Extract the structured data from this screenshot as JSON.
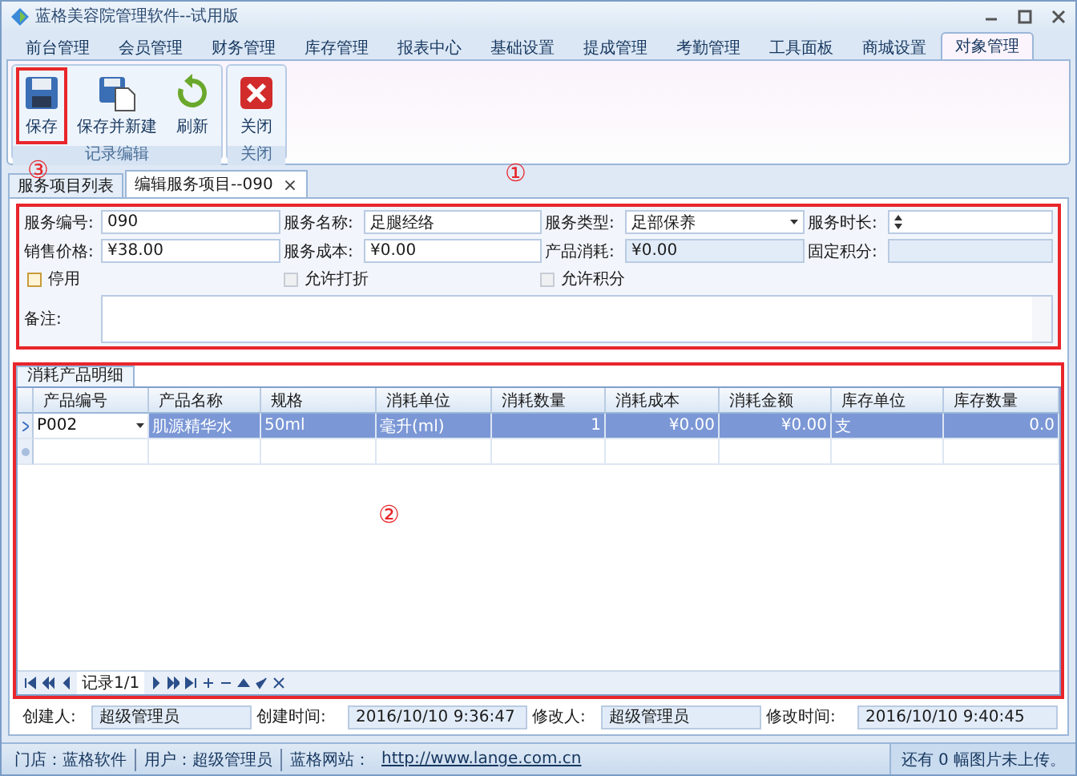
{
  "window": {
    "title": "蓝格美容院管理软件--试用版"
  },
  "menu_tabs": [
    {
      "label": "前台管理",
      "selected": false
    },
    {
      "label": "会员管理",
      "selected": false
    },
    {
      "label": "财务管理",
      "selected": false
    },
    {
      "label": "库存管理",
      "selected": false
    },
    {
      "label": "报表中心",
      "selected": false
    },
    {
      "label": "基础设置",
      "selected": false
    },
    {
      "label": "提成管理",
      "selected": false
    },
    {
      "label": "考勤管理",
      "selected": false
    },
    {
      "label": "工具面板",
      "selected": false
    },
    {
      "label": "商城设置",
      "selected": false
    },
    {
      "label": "对象管理",
      "selected": true
    }
  ],
  "ribbon": {
    "callout": "③",
    "groups": [
      {
        "label": "记录编辑",
        "buttons": [
          {
            "label": "保存",
            "kind": "save",
            "outlined": true
          },
          {
            "label": "保存并新建",
            "kind": "save-new",
            "outlined": false
          },
          {
            "label": "刷新",
            "kind": "refresh",
            "outlined": false
          }
        ]
      },
      {
        "label": "关闭",
        "buttons": [
          {
            "label": "关闭",
            "kind": "close",
            "outlined": false
          }
        ]
      }
    ]
  },
  "doc_tabs": [
    {
      "label": "服务项目列表",
      "selected": false,
      "closable": false
    },
    {
      "label": "编辑服务项目--090",
      "selected": true,
      "closable": true,
      "close_glyph": "×"
    }
  ],
  "form": {
    "callout": "①",
    "outlined": true,
    "rows": [
      [
        {
          "label": "服务编号:",
          "value": "090",
          "kind": "text"
        },
        {
          "label": "服务名称:",
          "value": "足腿经络",
          "kind": "text"
        },
        {
          "label": "服务类型:",
          "value": "足部保养",
          "kind": "select"
        },
        {
          "label": "服务时长:",
          "kind": "spin"
        }
      ],
      [
        {
          "label": "销售价格:",
          "value": "¥38.00",
          "kind": "text"
        },
        {
          "label": "服务成本:",
          "value": "¥0.00",
          "kind": "text"
        },
        {
          "label": "产品消耗:",
          "value": "¥0.00",
          "kind": "readonly"
        },
        {
          "label": "固定积分:",
          "kind": "readonly"
        }
      ]
    ],
    "checkboxes": [
      {
        "label": "停用",
        "checked": false,
        "disabled": false
      },
      {
        "label": "允许打折",
        "checked": false,
        "disabled": true
      },
      {
        "label": "允许积分",
        "checked": false,
        "disabled": true
      }
    ],
    "remark": {
      "label": "备注:"
    }
  },
  "detail": {
    "callout": "②",
    "outlined": true,
    "tab": "消耗产品明细",
    "columns": [
      "产品编号",
      "产品名称",
      "规格",
      "消耗单位",
      "消耗数量",
      "消耗成本",
      "消耗金额",
      "库存单位",
      "库存数量"
    ],
    "rows": [
      {
        "selected": true,
        "cells": [
          "P002",
          "肌源精华水",
          "50ml",
          "毫升(ml)",
          "1",
          "¥0.00",
          "¥0.00",
          "支",
          "0.0"
        ]
      }
    ],
    "navigator": {
      "record": "记录1/1"
    }
  },
  "audit": [
    {
      "label": "创建人:",
      "value": "超级管理员"
    },
    {
      "label": "创建时间:",
      "value": "2016/10/10 9:36:47"
    },
    {
      "label": "修改人:",
      "value": "超级管理员"
    },
    {
      "label": "修改时间:",
      "value": "2016/10/10 9:40:45"
    }
  ],
  "status_bar": {
    "items": [
      "门店：蓝格软件",
      "用户：超级管理员",
      "蓝格网站："
    ],
    "link": "http://www.lange.com.cn",
    "notice": "还有 0 幅图片未上传。"
  }
}
